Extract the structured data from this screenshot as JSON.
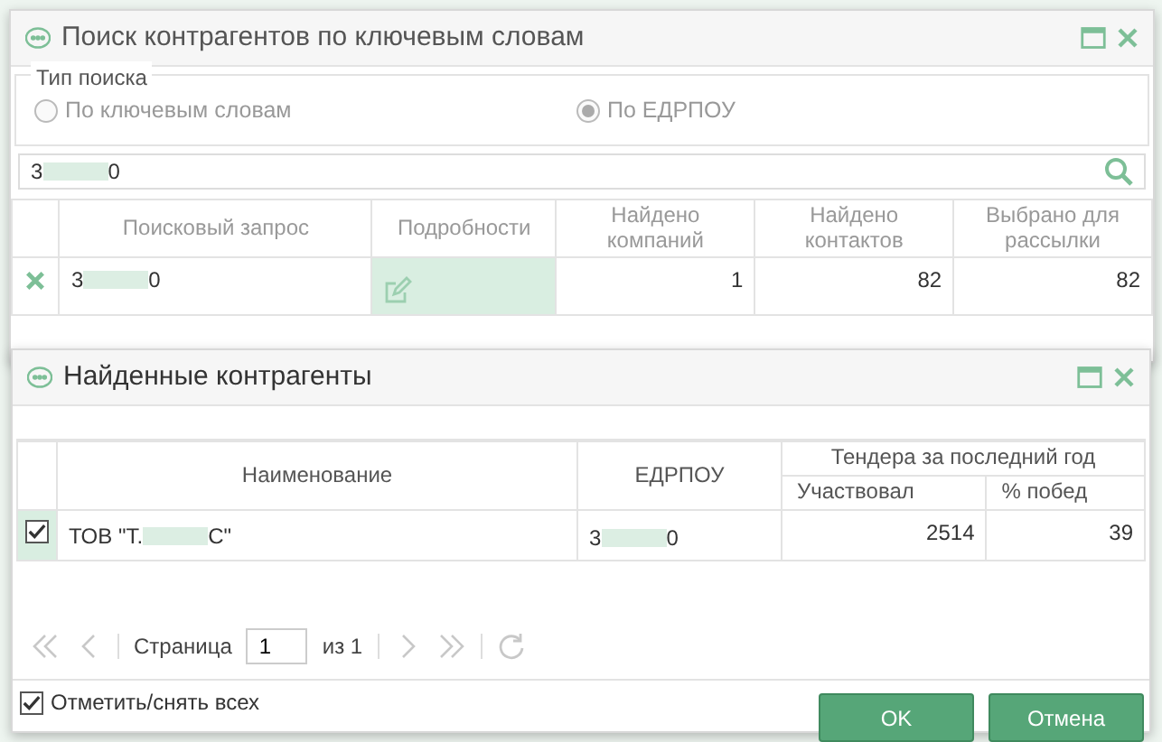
{
  "search_window": {
    "title": "Поиск контрагентов по ключевым словам",
    "search_type": {
      "legend": "Тип поиска",
      "options": [
        {
          "label": "По ключевым словам",
          "selected": false
        },
        {
          "label": "По ЕДРПОУ",
          "selected": true
        }
      ]
    },
    "query": {
      "prefix": "3",
      "suffix": "0"
    },
    "table": {
      "columns": [
        "Поисковый запрос",
        "Подробности",
        "Найдено компаний",
        "Найдено контактов",
        "Выбрано для рассылки"
      ],
      "rows": [
        {
          "query_prefix": "3",
          "query_suffix": "0",
          "details_selected": true,
          "companies": "1",
          "contacts": "82",
          "selected_for_mailing": "82"
        }
      ]
    }
  },
  "results_window": {
    "title": "Найденные контрагенты",
    "table": {
      "columns": [
        "Наименование",
        "ЕДРПОУ"
      ],
      "group": "Тендера за последний год",
      "subcolumns": [
        "Участвовал",
        "% побед"
      ],
      "rows": [
        {
          "checked": true,
          "name_prefix": "ТОВ \"Т.",
          "name_suffix": "С\"",
          "edrpou_prefix": "3",
          "edrpou_suffix": "0",
          "participated": "2514",
          "win_percent": "39"
        }
      ]
    },
    "pager": {
      "page_label": "Страница",
      "page": "1",
      "of": "из 1"
    },
    "select_all": {
      "label": "Отметить/снять всех",
      "checked": true
    },
    "buttons": [
      "OK",
      "Отмена"
    ]
  }
}
